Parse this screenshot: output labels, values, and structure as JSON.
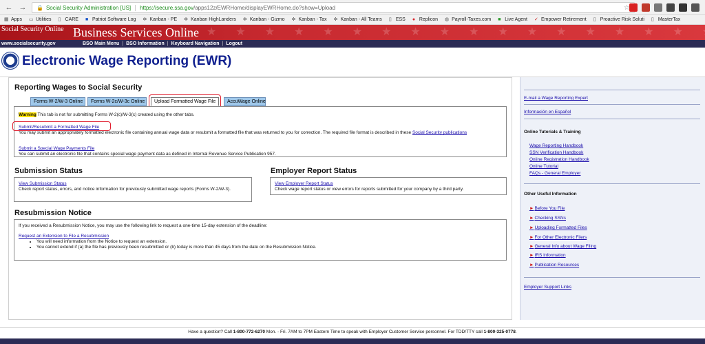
{
  "browser": {
    "site_chip": "Social Security Administration [US]",
    "url_host": "https://secure.ssa.gov",
    "url_path": "/apps12z/EWRHome/displayEWRHome.do?show=Upload",
    "bookmarks": [
      "Apps",
      "Utilities",
      "CARE",
      "Patriot Software Log",
      "Kanban - PE",
      "Kanban HighLanders",
      "Kanban - Gizmo",
      "Kanban - Tax",
      "Kanban - All Teams",
      "ESS",
      "Replicon",
      "Payroll-Taxes.com",
      "Live Agent",
      "Empower Retirement",
      "Proactive Risk Soluti",
      "MasterTax"
    ]
  },
  "banner": {
    "ssa_online": "Social Security Online",
    "title": "Business Services Online",
    "domain": "www.socialsecurity.gov",
    "nav": [
      "BSO Main Menu",
      "BSO Information",
      "Keyboard Navigation",
      "Logout"
    ]
  },
  "page": {
    "title": "Electronic Wage Reporting (EWR)"
  },
  "reporting": {
    "title": "Reporting Wages to Social Security",
    "tabs": [
      "Forms W-2/W-3 Online",
      "Forms W-2c/W-3c Online",
      "Upload Formatted Wage File",
      "AccuWage Online"
    ],
    "warning_label": "Warning",
    "warning_text": " This tab is not for submitting Forms W-2(c)/W-3(c) created using the other tabs.",
    "submit_link": "Submit/Resubmit a Formatted Wage File",
    "submit_desc": "You may submit an appropriately formatted electronic file containing annual wage data or resubmit a formatted file that was returned to you for correction. The required file format is described in these ",
    "submit_desc_link": "Social Security publications",
    "special_link": "Submit a Special Wage Payments File",
    "special_desc": "You can submit an electronic file that contains special wage payment data as defined in Internal Revenue Service Publication 957."
  },
  "submission": {
    "title": "Submission Status",
    "link": "View Submission Status",
    "desc": "Check report status, errors, and notice information for previously submitted wage reports (Forms W-2/W-3)."
  },
  "employer": {
    "title": "Employer Report Status",
    "link": "View Employer Report Status",
    "desc": "Check wage report status or view errors for reports submitted for your company by a third party."
  },
  "resubmission": {
    "title": "Resubmission Notice",
    "intro": "If you received a Resubmission Notice, you may use the following link to request a one-time 15-day extension of the deadline:",
    "link": "Request an Extension to File a Resubmission",
    "bullets": [
      "You will need information from the Notice to request an extension.",
      "You cannot extend if (a) the file has previously been resubmitted or (b) today is more than 45 days from the date on the Resubmission Notice."
    ]
  },
  "sidebar": {
    "email_link": "E-mail a Wage Reporting Expert",
    "spanish_link": "Información en Español",
    "tutorials_head": "Online Tutorials & Training",
    "tutorials": [
      "Wage Reporting Handbook",
      "SSN Verification Handbook",
      "Online Registration Handbook",
      "Online Tutorial",
      "FAQs - General Employer"
    ],
    "useful_head": "Other Useful Information",
    "useful": [
      "Before You File",
      "Checking SSNs",
      "Uploading Formatted Files",
      "For Other Electronic Filers",
      "General Info about Wage Filing",
      "IRS Information",
      "Publication Resources"
    ],
    "support_link": "Employer Support Links"
  },
  "footer": {
    "text_a": "Have a question? Call ",
    "phone1": "1-800-772-6270",
    "text_b": " Mon. - Fri. 7AM to 7PM Eastern Time to speak with Employer Customer Service personnel. For TDD/TTY call ",
    "phone2": "1-800-325-0778",
    "text_c": "."
  },
  "colors": {
    "banner_red": "#c82a30",
    "nav_navy": "#2b2b55",
    "tab_blue": "#9fc8ea",
    "title_blue": "#10208f",
    "callout_red": "#e01e2e",
    "warning_yellow": "#ffe200"
  }
}
